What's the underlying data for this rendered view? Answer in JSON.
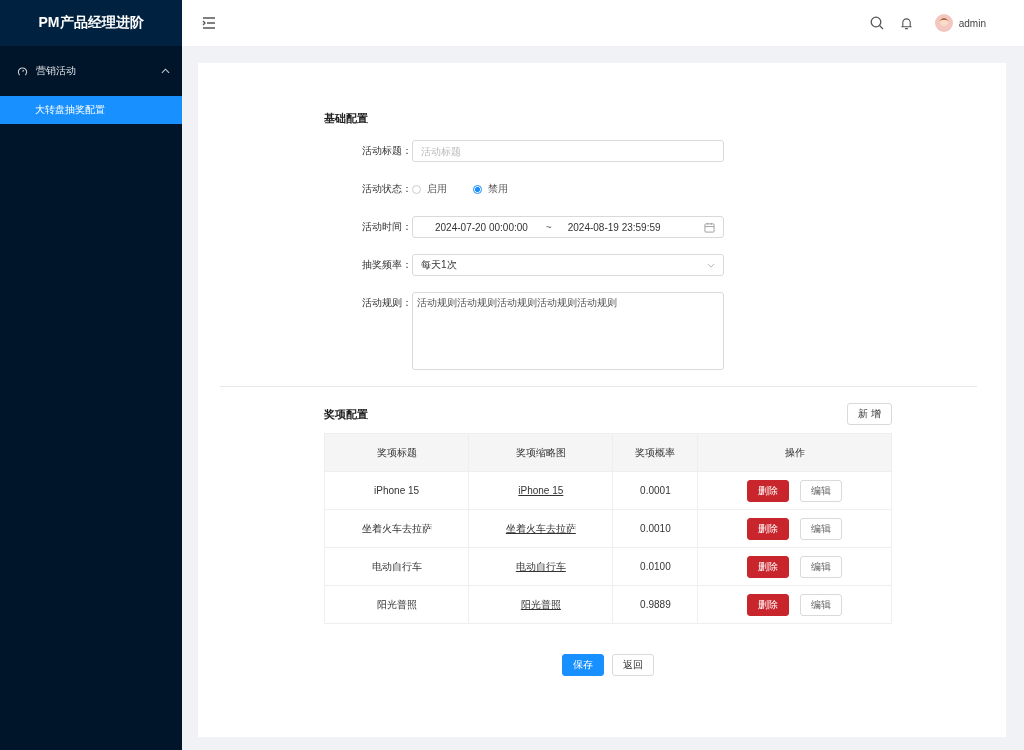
{
  "sidebar": {
    "logo": "PM产品经理进阶",
    "menus": [
      {
        "label": "营销活动",
        "expanded": true,
        "children": [
          {
            "label": "大转盘抽奖配置",
            "selected": true
          }
        ]
      }
    ]
  },
  "header": {
    "user": "admin"
  },
  "basic": {
    "title": "基础配置",
    "fields": [
      {
        "kind": "input",
        "label": "活动标题：",
        "placeholder": "活动标题"
      },
      {
        "kind": "radio",
        "label": "活动状态：",
        "options": [
          {
            "label": "启用",
            "selected": false
          },
          {
            "label": "禁用",
            "selected": true
          }
        ]
      },
      {
        "kind": "daterange",
        "label": "活动时间：",
        "start": "2024-07-20 00:00:00",
        "separator": "~",
        "end": "2024-08-19 23:59:59"
      },
      {
        "kind": "select",
        "label": "抽奖频率：",
        "value": "每天1次"
      },
      {
        "kind": "textarea",
        "label": "活动规则：",
        "value": "活动规则活动规则活动规则活动规则活动规则"
      }
    ]
  },
  "prizes": {
    "title": "奖项配置",
    "add_button": "新 增",
    "columns": [
      "奖项标题",
      "奖项缩略图",
      "奖项概率",
      "操作"
    ],
    "rows": [
      {
        "title": "iPhone 15",
        "thumbnail": "iPhone 15",
        "probability": "0.0001",
        "delete": "删除",
        "edit": "编辑"
      },
      {
        "title": "坐着火车去拉萨",
        "thumbnail": "坐着火车去拉萨",
        "probability": "0.0010",
        "delete": "删除",
        "edit": "编辑"
      },
      {
        "title": "电动自行车",
        "thumbnail": "电动自行车",
        "probability": "0.0100",
        "delete": "删除",
        "edit": "编辑"
      },
      {
        "title": "阳光普照",
        "thumbnail": "阳光普照",
        "probability": "0.9889",
        "delete": "删除",
        "edit": "编辑"
      }
    ]
  },
  "footer": {
    "save": "保存",
    "back": "返回"
  }
}
